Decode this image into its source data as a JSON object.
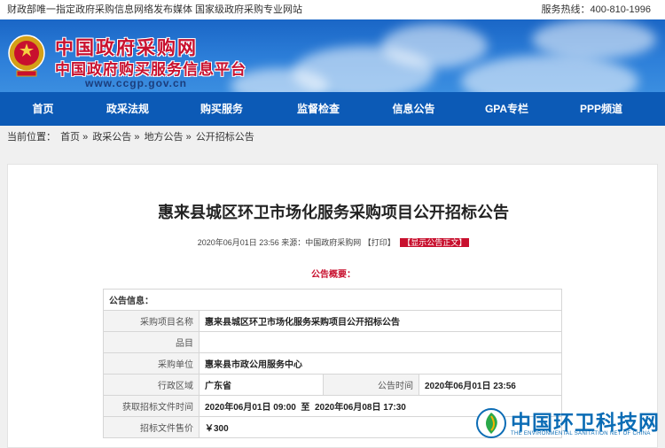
{
  "topbar": {
    "left": "财政部唯一指定政府采购信息网络发布媒体 国家级政府采购专业网站",
    "right": "服务热线：400-810-1996"
  },
  "brand": {
    "line1": "中国政府采购网",
    "line2": "中国政府购买服务信息平台",
    "url": "www.ccgp.gov.cn"
  },
  "nav": {
    "items": [
      "首页",
      "政采法规",
      "购买服务",
      "监督检查",
      "信息公告",
      "GPA专栏",
      "PPP频道"
    ]
  },
  "breadcrumb": {
    "prefix": "当前位置：",
    "items": [
      "首页",
      "政采公告",
      "地方公告",
      "公开招标公告"
    ],
    "separator": "»"
  },
  "article": {
    "title": "惠来县城区环卫市场化服务采购项目公开招标公告",
    "meta": "2020年06月01日 23:56 来源：中国政府采购网 【打印】",
    "show_body": "【显示公告正文】",
    "summary_label": "公告概要："
  },
  "info_table": {
    "header": "公告信息：",
    "project_name_label": "采购项目名称",
    "project_name": "惠来县城区环卫市场化服务采购项目公开招标公告",
    "item_label": "品目",
    "item_value": "",
    "unit_label": "采购单位",
    "unit_value": "惠来县市政公用服务中心",
    "region_label": "行政区域",
    "region_value": "广东省",
    "time_label": "公告时间",
    "time_value": "2020年06月01日 23:56",
    "doc_time_label": "获取招标文件时间",
    "doc_time_start": "2020年06月01日 09:00",
    "doc_time_to": "至",
    "doc_time_end": "2020年06月08日 17:30",
    "price_label": "招标文件售价",
    "price_value": "￥300"
  },
  "watermark": {
    "title": "中国环卫科技网",
    "subtitle": "THE ENVIRONMENTAL SANITATION NET OF CHINA"
  },
  "colors": {
    "nav_blue": "#0c5ab6",
    "brand_red": "#c8102e",
    "watermark_blue": "#0b6cb5"
  }
}
